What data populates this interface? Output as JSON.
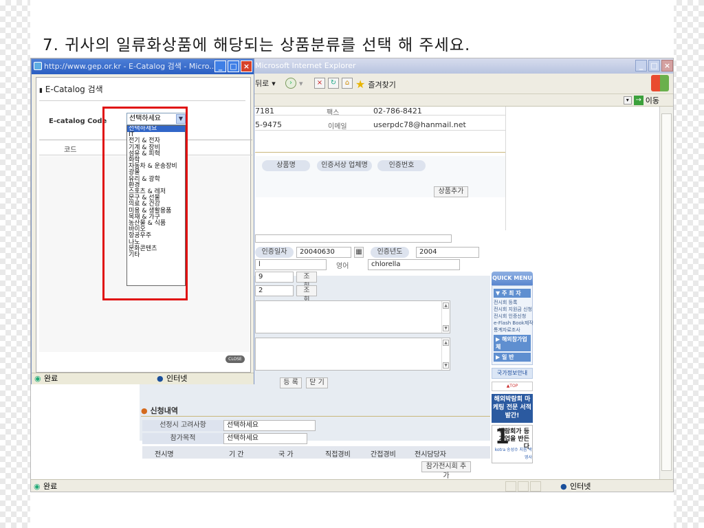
{
  "slide": {
    "heading": "7. 귀사의 일류화상품에 해당되는 상품분류를 선택 해 주세요."
  },
  "ie_window": {
    "title": "Microsoft Internet Explorer",
    "toolbar": {
      "back_label": "뒤로",
      "favorites_label": "즐겨찾기"
    },
    "address_go_label": "이동",
    "status": {
      "done_label": "완료",
      "zone_label": "인터넷"
    }
  },
  "page": {
    "phone": "7181",
    "fax_label": "팩스",
    "fax": "02-786-8421",
    "mobile": "5-9475",
    "email_label": "이메일",
    "email": "userpdc78@hanmail.net",
    "product_headers": [
      "상품명",
      "인증서상 업체명",
      "인증번호"
    ],
    "add_product_button": "상품추가",
    "cert_date_label": "인증일자",
    "cert_date": "20040630",
    "cert_year_label": "인증년도",
    "cert_year": "2004",
    "english_label": "영어",
    "english_value": "chlorella",
    "lookup_button": "조 회",
    "lookup_button2": "조 회",
    "frag_1": "l",
    "frag_2": "9",
    "frag_3": "2",
    "register_button": "등 록",
    "close_button": "닫 기",
    "application_title": "신청내역",
    "consider_label": "선정시 고려사항",
    "consider_value": "선택하세요",
    "purpose_label": "참가목적",
    "purpose_value": "선택하세요",
    "exhibit_headers": [
      "전시명",
      "기 간",
      "국 가",
      "직접경비",
      "간접경비",
      "전시담당자"
    ],
    "add_exhibit_button": "참가전시회 추가"
  },
  "quick_menu": {
    "header": "QUICK MENU",
    "section1": "▼ 주 최 자",
    "items": [
      "전시회 등록",
      "전시회 지원금 신청",
      "전시회 인증신청",
      "e-Flash Book제작",
      "통계자료조사"
    ],
    "section2": "▶ 해외참가업체",
    "section3": "▶ 일 반",
    "info_button": "국가정보안내",
    "top_button": "▲TOP",
    "ad1": "해외박람회 마케팅 전문 서적 발간!",
    "ad2_big": "1",
    "ad2_text": "박람회가 등기업을 반든다",
    "ad2_foot": "kotra 송성수 지음 박영사"
  },
  "popup": {
    "title": "http://www.gep.or.kr - E-Catalog 검색 - Micro...",
    "heading": "E-Catalog 검색",
    "field_label": "E-catalog Code",
    "select_value": "선택하세요",
    "options": [
      "선택하세요",
      "IT",
      "전기 & 전자",
      "기계 & 장비",
      "섬유 & 피혁",
      "화학",
      "자동차 & 운송장비",
      "광물",
      "유리 & 광학",
      "환경",
      "스포츠 & 레저",
      "문구 & 선물",
      "의료 & 건강",
      "미용 & 생활용품",
      "목재 & 가구",
      "농산물 & 식품",
      "바이오",
      "항공우주",
      "나노",
      "문화콘텐츠",
      "기타"
    ],
    "code_header": "코드",
    "close_label": "CLOSE",
    "status_done": "완료",
    "status_zone": "인터넷"
  }
}
